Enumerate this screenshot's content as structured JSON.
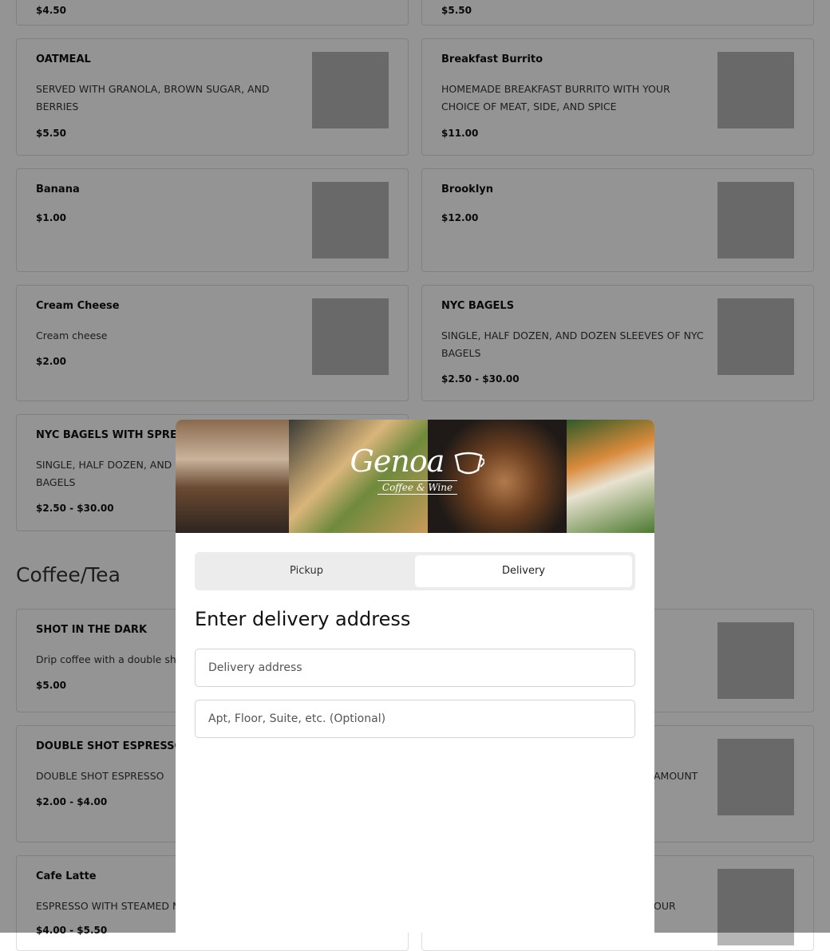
{
  "menu": {
    "top_row": [
      {
        "price": "$4.50"
      },
      {
        "price": "$5.50"
      }
    ],
    "items": [
      {
        "name": "OATMEAL",
        "description": "SERVED WITH GRANOLA, BROWN SUGAR, AND BERRIES",
        "price": "$5.50"
      },
      {
        "name": "Breakfast Burrito",
        "description": "HOMEMADE BREAKFAST BURRITO WITH YOUR CHOICE OF MEAT, SIDE, AND SPICE",
        "price": "$11.00"
      },
      {
        "name": "Banana",
        "description": "",
        "price": "$1.00"
      },
      {
        "name": "Brooklyn",
        "description": "",
        "price": "$12.00"
      },
      {
        "name": "Cream Cheese",
        "description": "Cream cheese",
        "price": "$2.00"
      },
      {
        "name": "NYC BAGELS",
        "description": "SINGLE, HALF DOZEN, AND DOZEN SLEEVES OF NYC BAGELS",
        "price": "$2.50 - $30.00"
      },
      {
        "name": "NYC BAGELS WITH SPREAD",
        "description": "SINGLE, HALF DOZEN, AND DOZEN SLEEVES OF NYC BAGELS",
        "price": "$2.50 - $30.00"
      }
    ],
    "section_title": "Coffee/Tea",
    "coffee_items": [
      {
        "name": "SHOT IN THE DARK",
        "description": "Drip coffee with a double shot of espresso",
        "price": "$5.00"
      },
      {
        "name": "DOUBLE SHOT ESPRESSO",
        "description": "DOUBLE SHOT ESPRESSO",
        "price": "$2.00 - $4.00"
      },
      {
        "name": "Cafe Latte",
        "description": "ESPRESSO WITH STEAMED MILK",
        "price": "$4.00 - $5.50"
      }
    ],
    "coffee_right_fragments": [
      {
        "text": "AMOUNT"
      },
      {
        "text": "OUR"
      }
    ]
  },
  "modal": {
    "logo_word": "Genoa",
    "logo_tagline": "Coffee & Wine",
    "tabs": [
      {
        "label": "Pickup",
        "active": false
      },
      {
        "label": "Delivery",
        "active": true
      }
    ],
    "heading": "Enter delivery address",
    "address_placeholder": "Delivery address",
    "apt_placeholder": "Apt, Floor, Suite, etc. (Optional)"
  },
  "colors": {
    "thumb": "#b5b5b5",
    "overlay": "rgba(0,0,0,0.42)",
    "toggle_bg": "#ececec"
  }
}
